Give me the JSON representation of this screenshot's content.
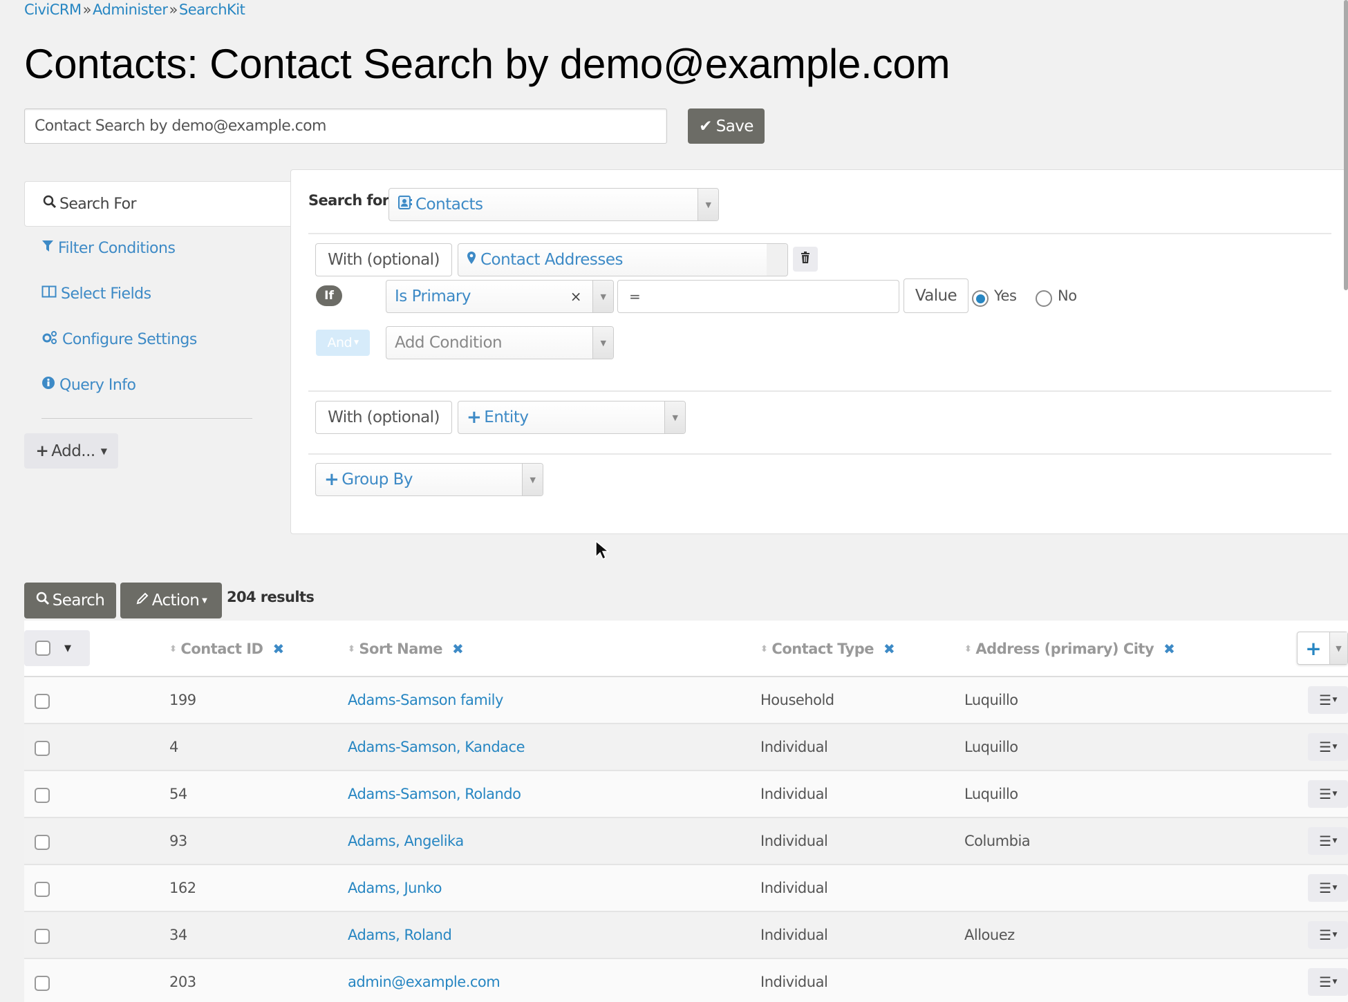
{
  "breadcrumb": [
    "CiviCRM",
    "Administer",
    "SearchKit"
  ],
  "breadcrumb_separator": "»",
  "page_title": "Contacts: Contact Search by demo@example.com",
  "name_input": {
    "value": "Contact Search by demo@example.com"
  },
  "save_button": {
    "icon": "check-icon",
    "label": "Save"
  },
  "sidebar": {
    "active_tab": {
      "icon": "search-icon",
      "label": "Search For"
    },
    "items": [
      {
        "icon": "filter-icon",
        "label": "Filter Conditions"
      },
      {
        "icon": "columns-icon",
        "label": "Select Fields"
      },
      {
        "icon": "cogs-icon",
        "label": "Configure Settings"
      },
      {
        "icon": "info-circle-icon",
        "label": "Query Info"
      }
    ],
    "add_button": {
      "label": "Add..."
    }
  },
  "search_panel": {
    "search_for_label": "Search for",
    "search_for_value": "Contacts",
    "join": {
      "type_label": "With (optional)",
      "entity": "Contact Addresses",
      "condition": {
        "if_label": "If",
        "field": "Is Primary",
        "operator": "=",
        "value_label": "Value",
        "options": [
          {
            "label": "Yes",
            "checked": true
          },
          {
            "label": "No",
            "checked": false
          }
        ]
      },
      "and_label": "And",
      "add_condition_placeholder": "Add Condition"
    },
    "join2": {
      "type_label": "With (optional)",
      "entity_placeholder": "Entity"
    },
    "group_by_placeholder": "Group By"
  },
  "results_toolbar": {
    "search_label": "Search",
    "action_label": "Action",
    "results_count": "204 results"
  },
  "table": {
    "columns": [
      "Contact ID",
      "Sort Name",
      "Contact Type",
      "Address (primary) City"
    ],
    "rows": [
      {
        "id": "199",
        "sort_name": "Adams-Samson family",
        "type": "Household",
        "city": "Luquillo"
      },
      {
        "id": "4",
        "sort_name": "Adams-Samson, Kandace",
        "type": "Individual",
        "city": "Luquillo"
      },
      {
        "id": "54",
        "sort_name": "Adams-Samson, Rolando",
        "type": "Individual",
        "city": "Luquillo"
      },
      {
        "id": "93",
        "sort_name": "Adams, Angelika",
        "type": "Individual",
        "city": "Columbia"
      },
      {
        "id": "162",
        "sort_name": "Adams, Junko",
        "type": "Individual",
        "city": ""
      },
      {
        "id": "34",
        "sort_name": "Adams, Roland",
        "type": "Individual",
        "city": "Allouez"
      },
      {
        "id": "203",
        "sort_name": "admin@example.com",
        "type": "Individual",
        "city": ""
      }
    ]
  },
  "colors": {
    "link": "#2786c2",
    "dark_button": "#6c6c66",
    "background": "#f1f1f1"
  }
}
